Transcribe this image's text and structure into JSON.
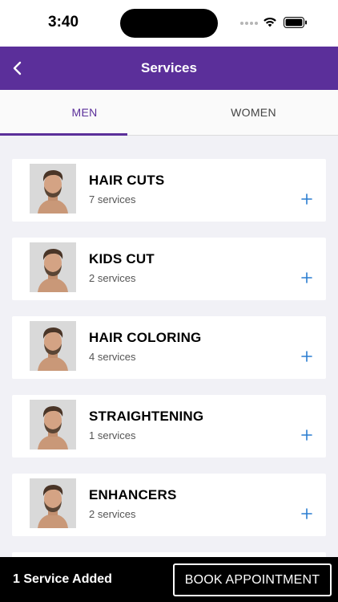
{
  "status_bar": {
    "time": "3:40"
  },
  "header": {
    "title": "Services"
  },
  "tabs": [
    {
      "label": "MEN",
      "active": true
    },
    {
      "label": "WOMEN",
      "active": false
    }
  ],
  "services": [
    {
      "name": "HAIR CUTS",
      "count": "7 services"
    },
    {
      "name": "KIDS CUT",
      "count": "2 services"
    },
    {
      "name": "HAIR COLORING",
      "count": "4 services"
    },
    {
      "name": "STRAIGHTENING",
      "count": "1 services"
    },
    {
      "name": "ENHANCERS",
      "count": "2 services"
    }
  ],
  "bottom_bar": {
    "added_text": "1 Service Added",
    "book_label": "BOOK APPOINTMENT"
  },
  "colors": {
    "accent": "#5b2f9a",
    "add_icon": "#2a7dd1",
    "bottom_bar": "#000000",
    "background": "#f1f1f6"
  },
  "icons": {
    "back": "chevron-left-icon",
    "add": "plus-icon",
    "wifi": "wifi-icon",
    "battery": "battery-icon"
  }
}
